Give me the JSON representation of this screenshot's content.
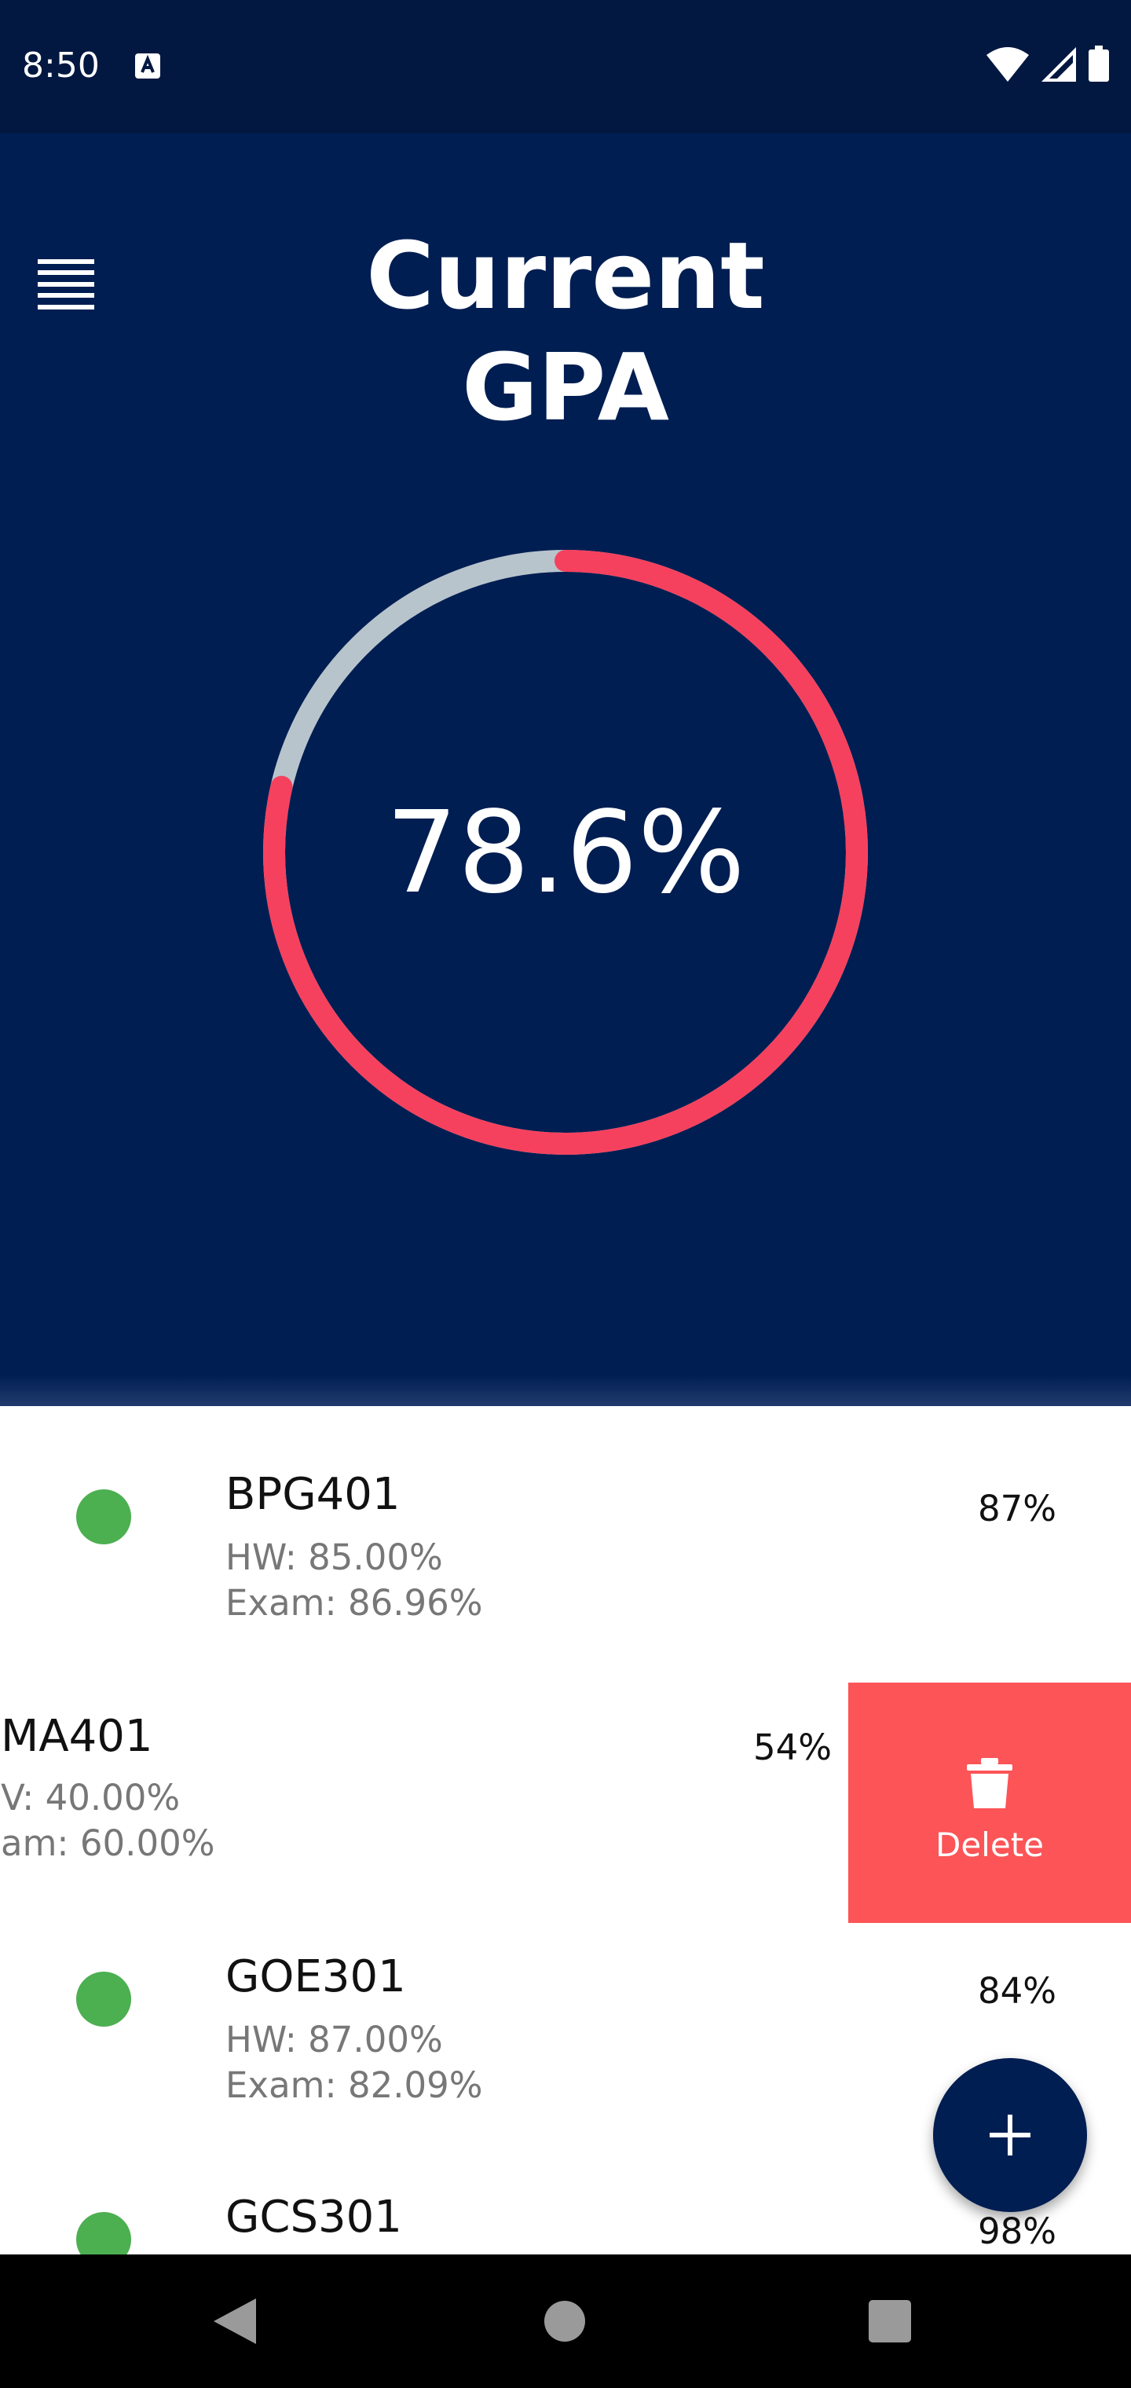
{
  "status_bar": {
    "time": "8:50"
  },
  "header": {
    "title_line1": "Current",
    "title_line2": "GPA"
  },
  "gpa": {
    "value_label": "78.6%",
    "ring_fraction": 0.786,
    "ring_color": "#f5415e",
    "track_color": "#b8c4cc"
  },
  "courses": [
    {
      "code": "BPG401",
      "hw": "HW: 85.00%",
      "exam": "Exam: 86.96%",
      "pct": "87%",
      "status_color": "#4caf50"
    },
    {
      "code": "MA401",
      "hw": "V: 40.00%",
      "exam": "am: 60.00%",
      "pct": "54%"
    },
    {
      "code": "GOE301",
      "hw": "HW: 87.00%",
      "exam": "Exam: 82.09%",
      "pct": "84%",
      "status_color": "#4caf50"
    },
    {
      "code": "GCS301",
      "pct": "98%",
      "status_color": "#4caf50"
    }
  ],
  "swipe_action": {
    "label": "Delete",
    "color": "#fc5457",
    "icon": "trash-icon"
  },
  "fab": {
    "icon": "plus-icon"
  },
  "colors": {
    "primary_dark": "#001e52",
    "status_bar": "#021840",
    "text_secondary": "#777777"
  }
}
